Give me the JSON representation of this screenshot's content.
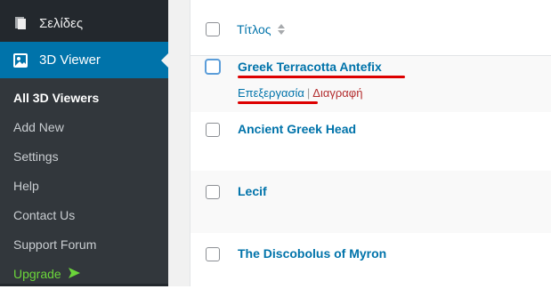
{
  "sidebar": {
    "pages_label": "Σελίδες",
    "active_menu_label": "3D Viewer",
    "submenu": [
      {
        "label": "All 3D Viewers"
      },
      {
        "label": "Add New"
      },
      {
        "label": "Settings"
      },
      {
        "label": "Help"
      },
      {
        "label": "Contact Us"
      },
      {
        "label": "Support Forum"
      },
      {
        "label": "Upgrade"
      }
    ]
  },
  "table": {
    "header_title": "Τίτλος",
    "rows": [
      {
        "title": "Greek Terracotta Antefix",
        "actions": {
          "edit": "Επεξεργασία",
          "separator": "|",
          "delete": "Διαγραφή"
        }
      },
      {
        "title": "Ancient Greek Head"
      },
      {
        "title": "Lecif"
      },
      {
        "title": "The Discobolus of Myron"
      }
    ]
  },
  "colors": {
    "sidebar_bg": "#23282d",
    "active_bg": "#0073aa",
    "link": "#0073aa",
    "delete": "#b32d2e",
    "upgrade": "#6bd63a",
    "annotation_underline": "#dd0000"
  }
}
